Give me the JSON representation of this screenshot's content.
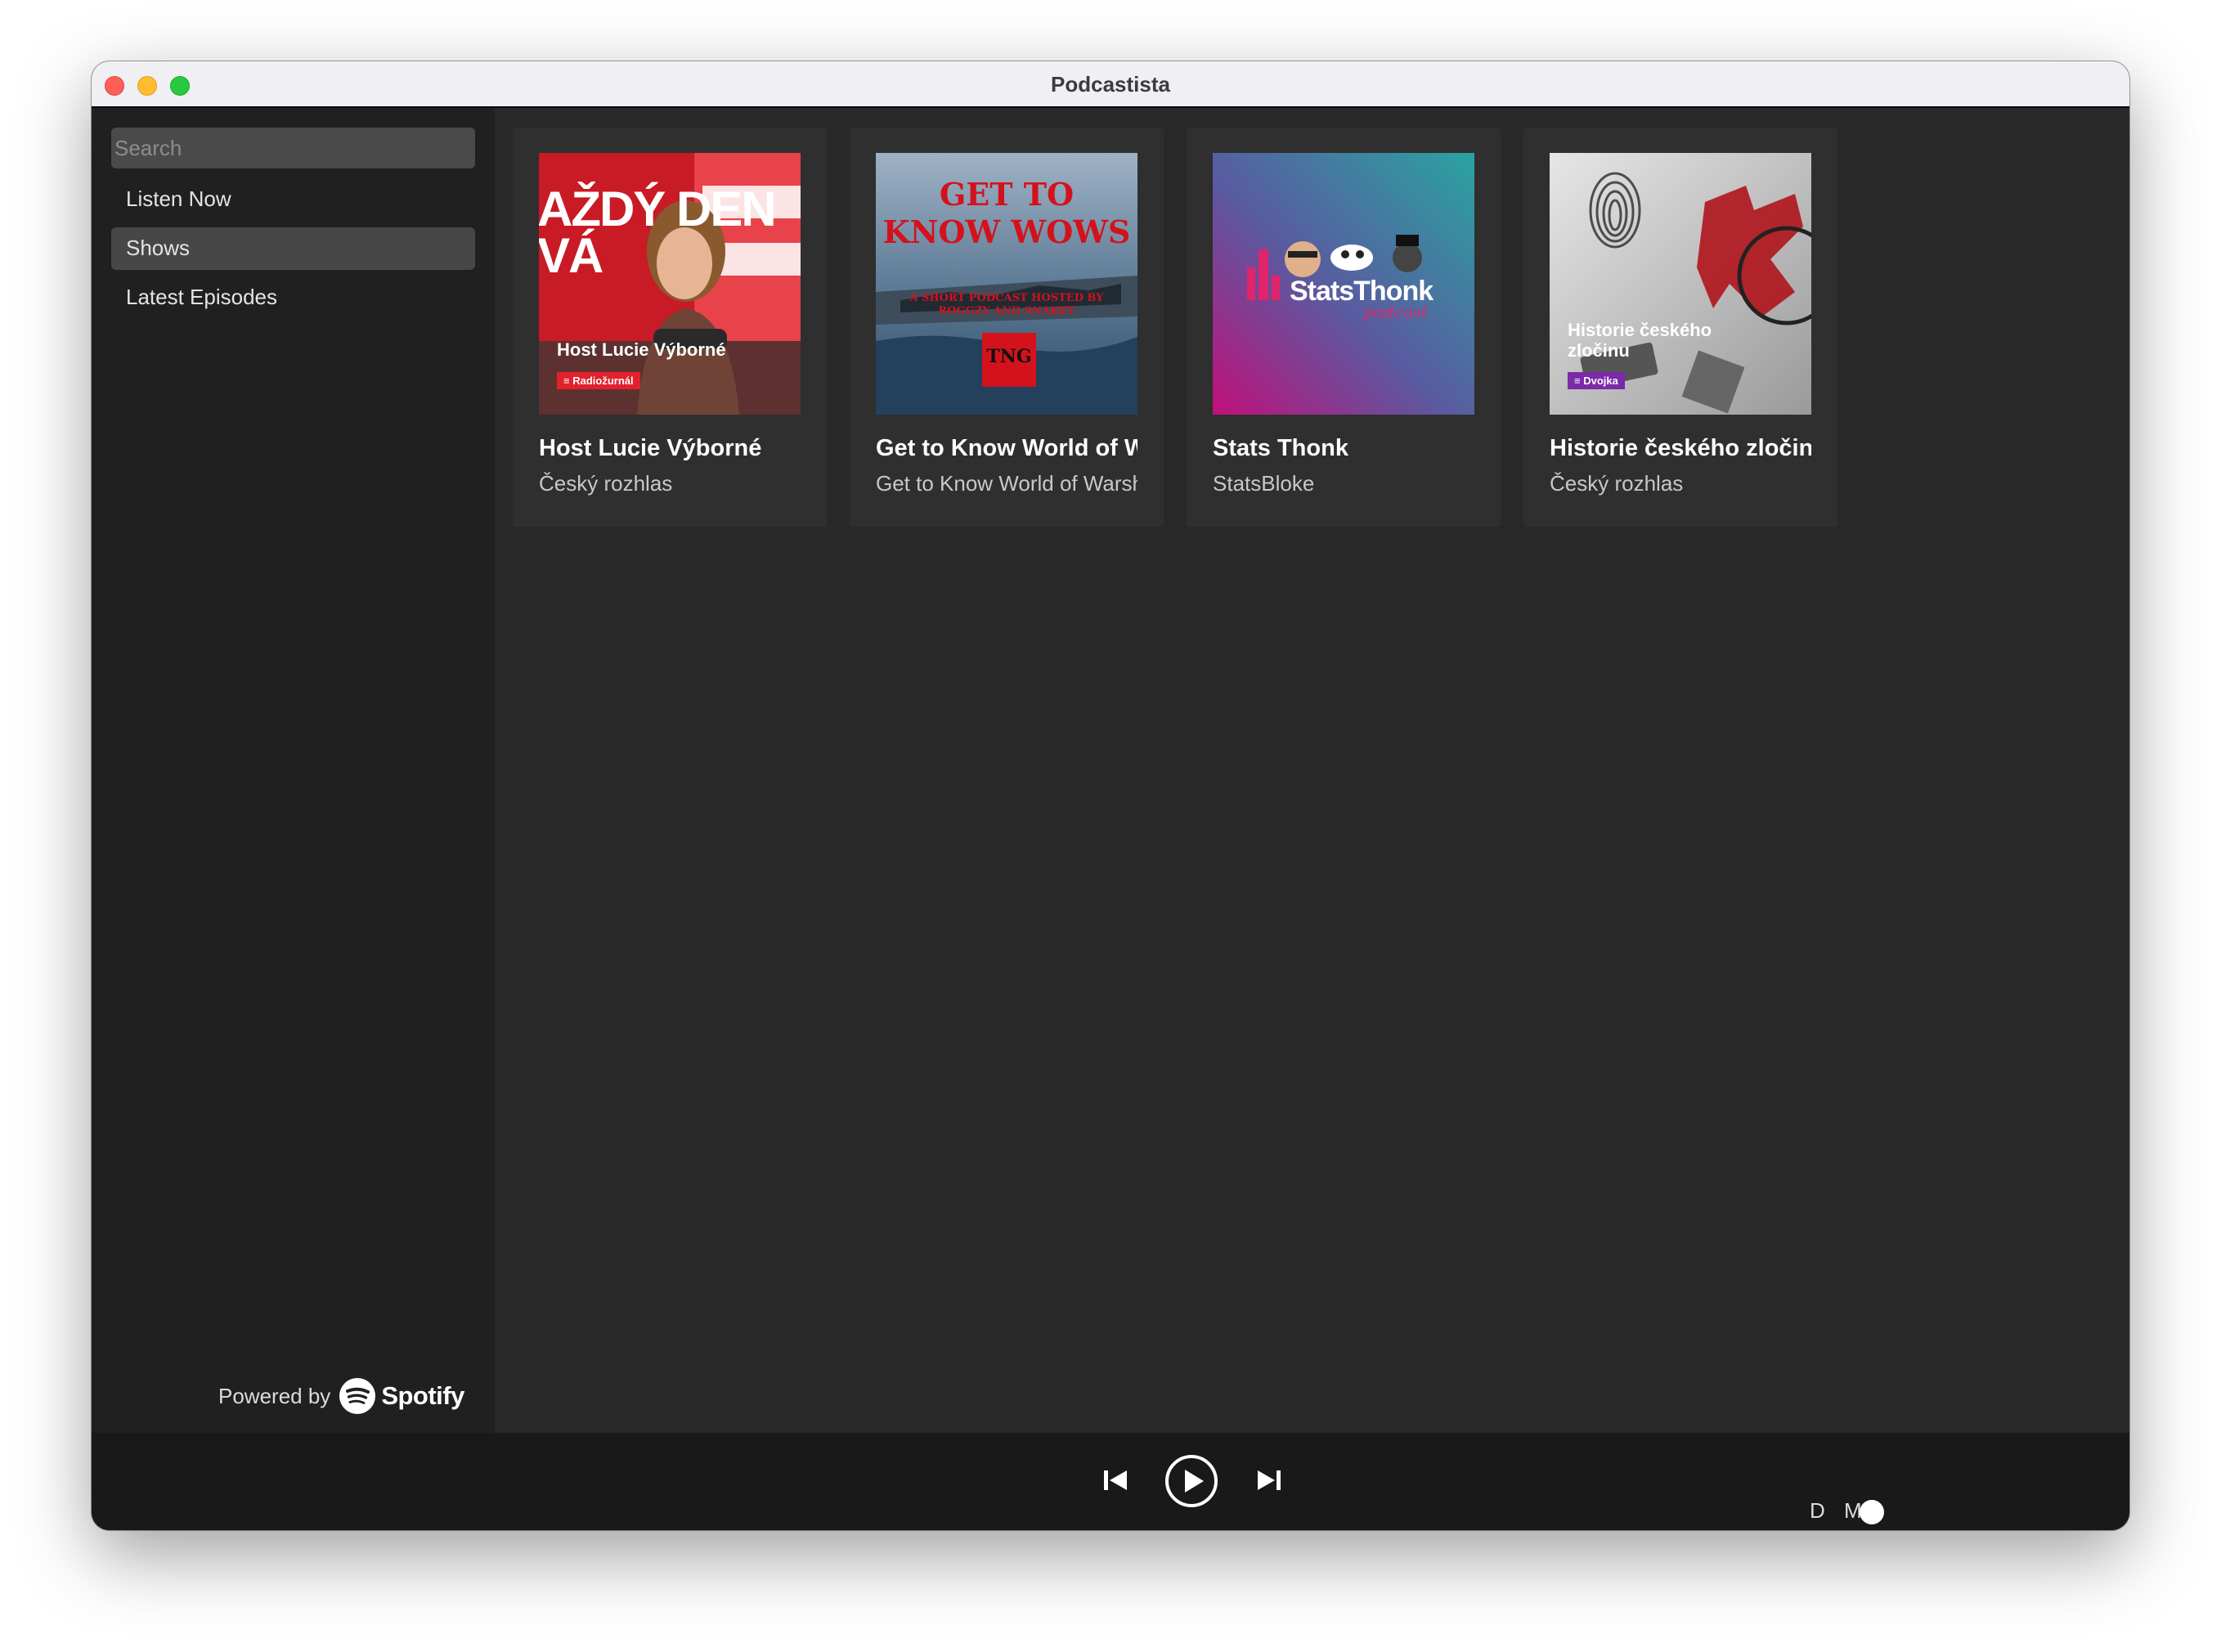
{
  "window": {
    "title": "Podcastista"
  },
  "sidebar": {
    "search_placeholder": "Search",
    "items": [
      {
        "label": "Listen Now",
        "active": false
      },
      {
        "label": "Shows",
        "active": true
      },
      {
        "label": "Latest Episodes",
        "active": false
      }
    ],
    "powered_by": "Powered by",
    "brand": "Spotify"
  },
  "shows": [
    {
      "title": "Host Lucie Výborné",
      "publisher": "Český rozhlas",
      "cover": {
        "big_text": "AŽDÝ DEN VÁ",
        "caption": "Host Lucie Výborné",
        "badge": "Radiožurnál",
        "colors": [
          "#e2212c",
          "#f6f6f6"
        ]
      }
    },
    {
      "title": "Get to Know World of Warships",
      "publisher": "Get to Know World of Warships",
      "cover": {
        "headline": "GET TO KNOW WOWS",
        "tagline": "A SHORT PODCAST HOSTED BY ROGGZY AND SNAKEY",
        "badge": "TNG",
        "colors": [
          "#5d7fa1",
          "#d3121c"
        ]
      }
    },
    {
      "title": "Stats Thonk",
      "publisher": "StatsBloke",
      "cover": {
        "logo_text": "StatsThonk",
        "logo_sub": "podcast",
        "colors": [
          "#2d9d9a",
          "#b5127a"
        ]
      }
    },
    {
      "title": "Historie českého zločinu",
      "publisher": "Český rozhlas",
      "cover": {
        "caption": "Historie českého zločinu",
        "badge": "Dvojka",
        "colors": [
          "#d8d8d8",
          "#c8141e",
          "#7b2aa8"
        ]
      }
    }
  ],
  "player": {
    "previous_icon": "skip-back-icon",
    "play_icon": "play-circle-icon",
    "next_icon": "skip-forward-icon",
    "dark_mode_label": "D M",
    "dark_mode_on": true
  }
}
